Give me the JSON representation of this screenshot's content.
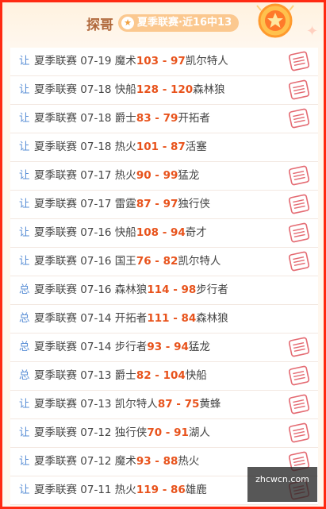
{
  "header": {
    "title": "探哥",
    "badge": "夏季联赛·近16中13"
  },
  "rows": [
    {
      "tag": "让",
      "text": "夏季联赛 07-19 魔术",
      "score": "103 - 97",
      "after": "凯尔特人",
      "hit": true
    },
    {
      "tag": "让",
      "text": "夏季联赛 07-18 快船",
      "score": "128 - 120",
      "after": "森林狼",
      "hit": true
    },
    {
      "tag": "让",
      "text": "夏季联赛 07-18 爵士",
      "score": "83 - 79",
      "after": "开拓者",
      "hit": true
    },
    {
      "tag": "让",
      "text": "夏季联赛 07-18 热火",
      "score": "101 - 87",
      "after": "活塞",
      "hit": false
    },
    {
      "tag": "让",
      "text": "夏季联赛 07-17 热火",
      "score": "90 - 99",
      "after": "猛龙",
      "hit": true
    },
    {
      "tag": "让",
      "text": "夏季联赛 07-17 雷霆",
      "score": "87 - 97",
      "after": "独行侠",
      "hit": true
    },
    {
      "tag": "让",
      "text": "夏季联赛 07-16 快船",
      "score": "108 - 94",
      "after": "奇才",
      "hit": true
    },
    {
      "tag": "让",
      "text": "夏季联赛 07-16 国王",
      "score": "76 - 82",
      "after": "凯尔特人",
      "hit": true
    },
    {
      "tag": "总",
      "text": "夏季联赛 07-16 森林狼",
      "score": "114 - 98",
      "after": "步行者",
      "hit": false
    },
    {
      "tag": "总",
      "text": "夏季联赛 07-14 开拓者",
      "score": "111 - 84",
      "after": "森林狼",
      "hit": false
    },
    {
      "tag": "总",
      "text": "夏季联赛 07-14 步行者",
      "score": "93 - 94",
      "after": "猛龙",
      "hit": true
    },
    {
      "tag": "总",
      "text": "夏季联赛 07-13 爵士",
      "score": "82 - 104",
      "after": "快船",
      "hit": true
    },
    {
      "tag": "让",
      "text": "夏季联赛 07-13 凯尔特人",
      "score": "87 - 75",
      "after": "黄蜂",
      "hit": true
    },
    {
      "tag": "让",
      "text": "夏季联赛 07-12 独行侠",
      "score": "70 - 91",
      "after": "湖人",
      "hit": true
    },
    {
      "tag": "让",
      "text": "夏季联赛 07-12 魔术",
      "score": "93 - 88",
      "after": "热火",
      "hit": true
    },
    {
      "tag": "让",
      "text": "夏季联赛 07-11 热火",
      "score": "119 - 86",
      "after": "雄鹿",
      "hit": true
    }
  ],
  "watermark": {
    "line1": "",
    "line2": "zhcwcn.com"
  },
  "colors": {
    "border": "#ff2a12",
    "score": "#e8531c",
    "tag": "#5a8fd6",
    "stamp": "#e46a72"
  },
  "icons": {
    "stamp": "stamp-icon",
    "medal": "medal-star-icon"
  }
}
